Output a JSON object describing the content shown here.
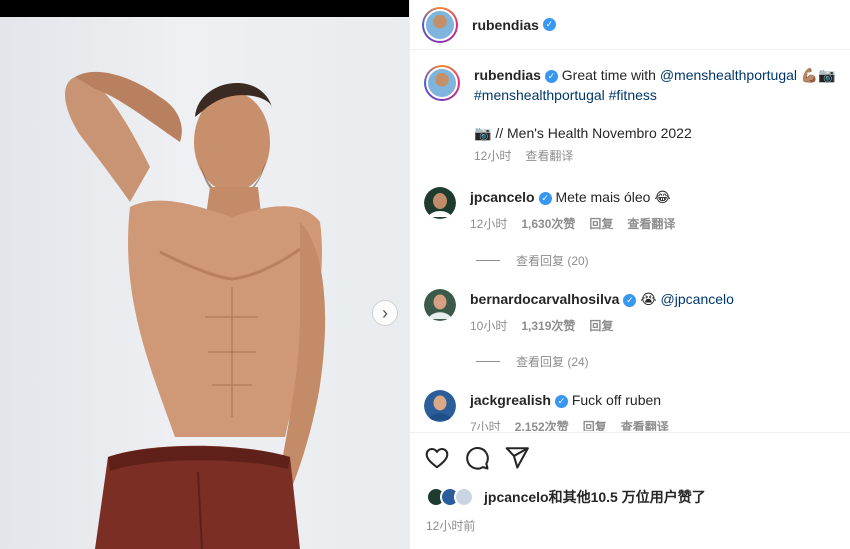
{
  "post": {
    "username": "rubendias",
    "caption_prefix": "Great time with",
    "caption_mention": "@menshealthportugal",
    "caption_emojis": "💪🏽📷",
    "caption_tags": "#menshealthportugal #fitness",
    "caption_credit": "📷 // Men's Health Novembro 2022",
    "caption_time": "12小时",
    "caption_translate": "查看翻译"
  },
  "comments": [
    {
      "username": "jpcancelo",
      "text": "Mete mais óleo",
      "emoji": "😂",
      "time": "12小时",
      "likes": "1,630次赞",
      "reply": "回复",
      "translate": "查看翻译",
      "view_replies": "查看回复 (20)"
    },
    {
      "username": "bernardocarvalhosilva",
      "text": "",
      "emoji": "😭",
      "mention": "@jpcancelo",
      "time": "10小时",
      "likes": "1,319次赞",
      "reply": "回复",
      "view_replies": "查看回复 (24)"
    },
    {
      "username": "jackgrealish",
      "text": "Fuck off ruben",
      "time": "7小时",
      "likes": "2,152次赞",
      "reply": "回复",
      "translate": "查看翻译"
    }
  ],
  "footer": {
    "likes_text": "jpcancelo和其他10.5 万位用户赞了",
    "posted_ago": "12小时前"
  },
  "icons": [
    "heart-icon",
    "comment-icon",
    "share-icon",
    "verified-icon",
    "chevron-right-icon"
  ],
  "colors": {
    "link": "#00376b",
    "verified": "#3897f0",
    "muted": "#8e8e8e",
    "text": "#262626"
  }
}
